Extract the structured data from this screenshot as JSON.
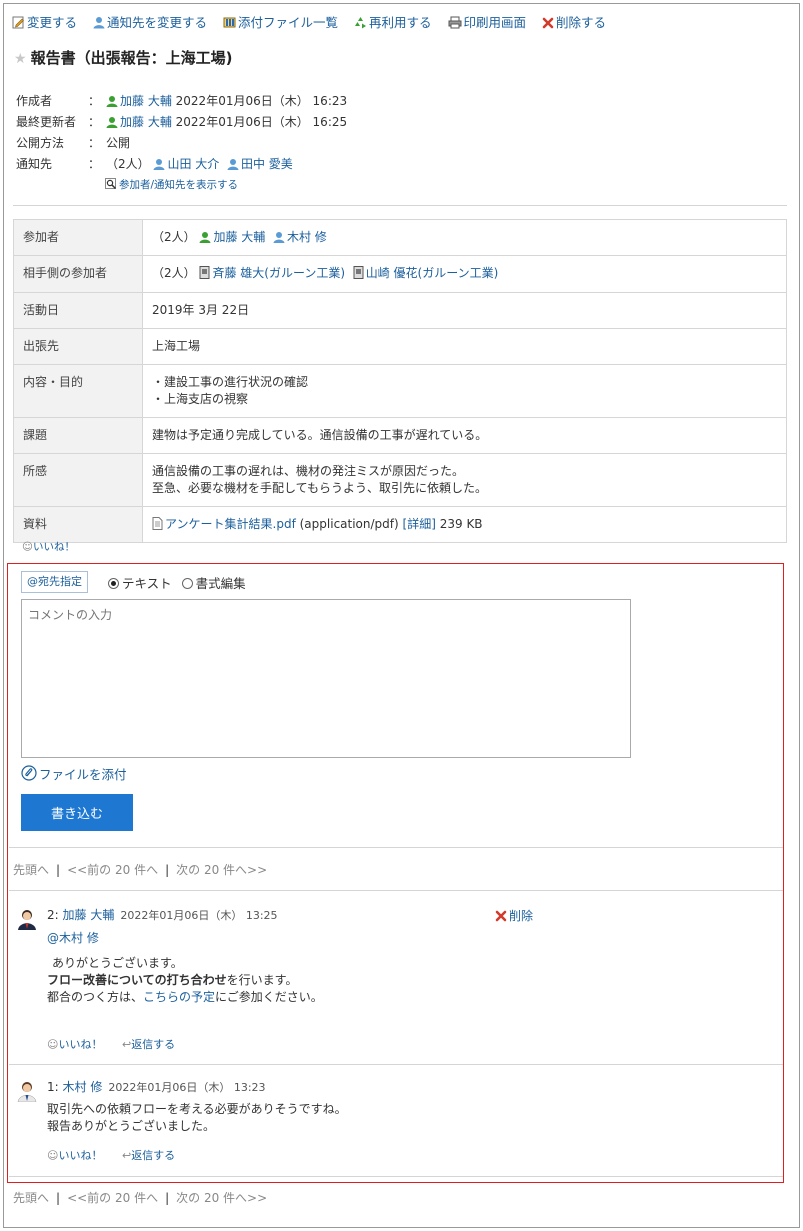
{
  "toolbar": {
    "edit": "変更する",
    "change_notify": "通知先を変更する",
    "attachments": "添付ファイル一覧",
    "reuse": "再利用する",
    "print": "印刷用画面",
    "delete": "削除する"
  },
  "report": {
    "title": "報告書（出張報告：上海工場)",
    "meta": {
      "creator_label": "作成者",
      "creator_name": "加藤 大輔",
      "creator_date": "2022年01月06日（木） 16:23",
      "updater_label": "最終更新者",
      "updater_name": "加藤 大輔",
      "updater_date": "2022年01月06日（木） 16:25",
      "publish_label": "公開方法",
      "publish_value": "公開",
      "notify_label": "通知先",
      "notify_count": "（2人）",
      "notify_user1": "山田 大介",
      "notify_user2": "田中 愛美",
      "show_link": "参加者/通知先を表示する",
      "colon": "："
    },
    "props": {
      "participants_label": "参加者",
      "participants_count": "（2人）",
      "participant1": "加藤 大輔",
      "participant2": "木村 修",
      "counterpart_label": "相手側の参加者",
      "counterpart_count": "（2人）",
      "counterpart1": "斉藤 雄大(ガルーン工業)",
      "counterpart2": "山崎 優花(ガルーン工業)",
      "date_label": "活動日",
      "date_value": "2019年 3月 22日",
      "destination_label": "出張先",
      "destination_value": "上海工場",
      "purpose_label": "内容・目的",
      "purpose_line1": "・建設工事の進行状況の確認",
      "purpose_line2": "・上海支店の視察",
      "issue_label": "課題",
      "issue_value": "建物は予定通り完成している。通信設備の工事が遅れている。",
      "impression_label": "所感",
      "impression_line1": "通信設備の工事の遅れは、機材の発注ミスが原因だった。",
      "impression_line2": "至急、必要な機材を手配してもらうよう、取引先に依頼した。",
      "material_label": "資料",
      "file_name": "アンケート集計結果.pdf",
      "file_type": "(application/pdf)",
      "file_detail": "[詳細]",
      "file_size": "239 KB"
    },
    "like": "いいね！"
  },
  "composer": {
    "address_button": "@宛先指定",
    "mode_text": "テキスト",
    "mode_rich": "書式編集",
    "mode_selected": "テキスト",
    "placeholder": "コメントの入力",
    "attach": "ファイルを添付",
    "submit": "書き込む"
  },
  "pager": {
    "first": "先頭へ",
    "prev": "<<前の 20 件へ",
    "next": "次の 20 件へ>>",
    "sep": "|"
  },
  "comments": [
    {
      "number": "2:",
      "author": "加藤 大輔",
      "date": "2022年01月06日（木） 13:25",
      "mention": "@木村 修",
      "line1": "ありがとうございます。",
      "line2_bold": "フロー改善についての打ち合わせ",
      "line2_rest": "を行います。",
      "line3_pre": "都合のつく方は、",
      "line3_link": "こちらの予定",
      "line3_post": "にご参加ください。",
      "like": "いいね！",
      "reply": "返信する",
      "delete": "削除"
    },
    {
      "number": "1:",
      "author": "木村 修",
      "date": "2022年01月06日（木） 13:23",
      "line1": "取引先への依頼フローを考える必要がありそうですね。",
      "line2": "報告ありがとうございました。",
      "like": "いいね！",
      "reply": "返信する"
    }
  ],
  "colors": {
    "link": "#1b5f9c",
    "accent_button": "#1e78d2",
    "highlight_border": "#e02020",
    "user_icon_green": "#3aa032",
    "user_icon_blue": "#5b9bd5"
  }
}
